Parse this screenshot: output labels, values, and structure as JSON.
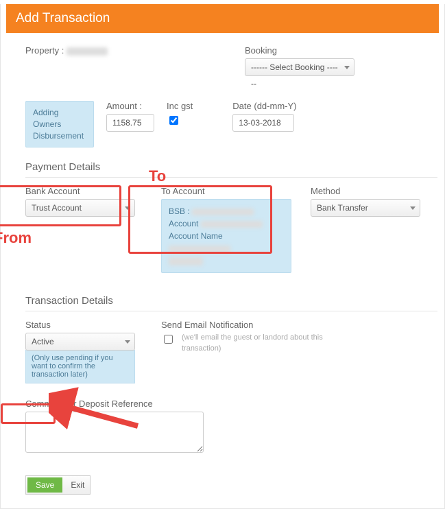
{
  "header": {
    "title": "Add Transaction"
  },
  "top": {
    "property_label": "Property :",
    "booking_label": "Booking",
    "booking_value": "------ Select Booking ------"
  },
  "main": {
    "box_line1": "Adding",
    "box_line2": "Owners",
    "box_line3": "Disbursement",
    "amount_label": "Amount :",
    "amount_value": "1158.75",
    "incgst_label": "Inc gst",
    "date_label": "Date (dd-mm-Y)",
    "date_value": "13-03-2018"
  },
  "payment": {
    "section": "Payment Details",
    "bank_label": "Bank Account",
    "bank_value": "Trust Account",
    "to_label": "To Account",
    "to_bsb": "BSB :",
    "to_account": "Account",
    "to_name": "Account Name",
    "method_label": "Method",
    "method_value": "Bank Transfer"
  },
  "transaction": {
    "section": "Transaction Details",
    "status_label": "Status",
    "status_value": "Active",
    "status_note": "(Only use pending if you want to confirm the transaction later)",
    "email_label": "Send Email Notification",
    "email_note": "(we'll email the guest or landord about this transaction)",
    "comment_label": "Comment Or Deposit Reference"
  },
  "actions": {
    "save": "Save",
    "exit": "Exit"
  },
  "annotations": {
    "from": "From",
    "to": "To"
  }
}
